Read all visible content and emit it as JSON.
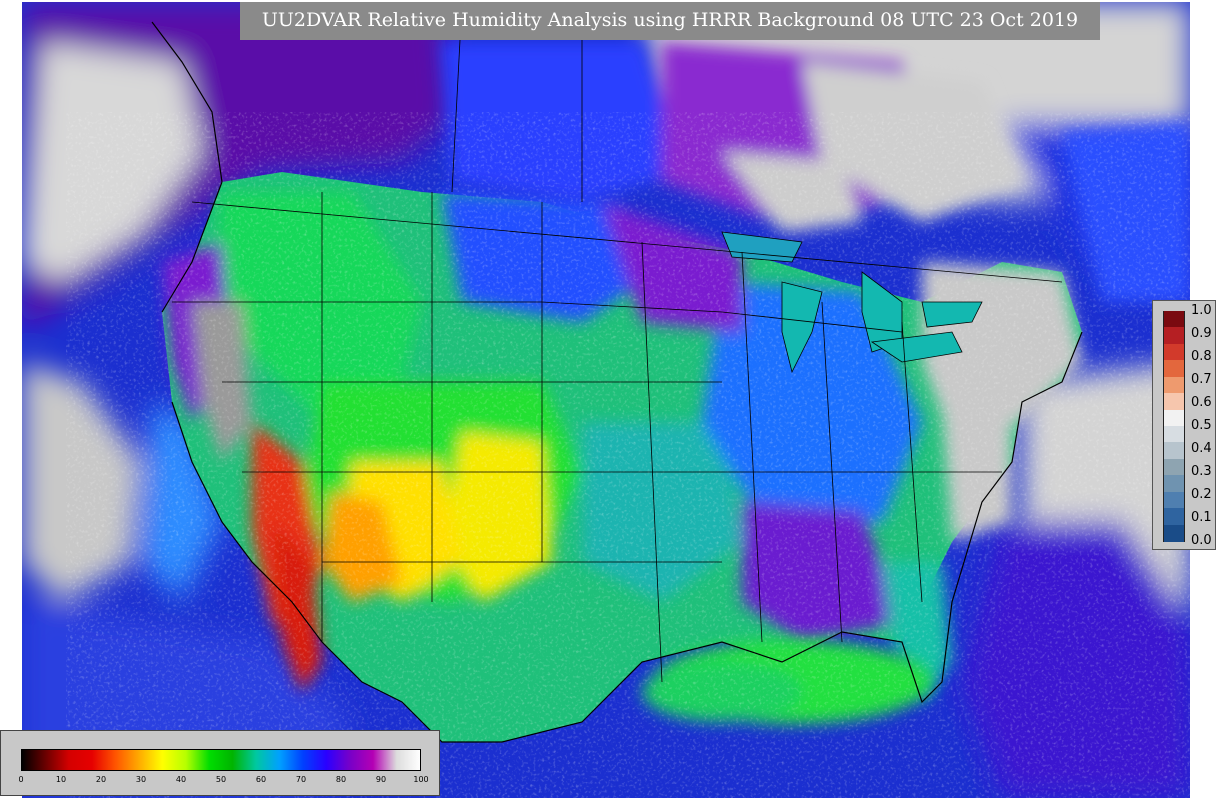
{
  "title": "UU2DVAR Relative Humidity Analysis using HRRR Background 08 UTC 23 Oct 2019",
  "colorbar_right": {
    "ticks": [
      "1.0",
      "0.9",
      "0.8",
      "0.7",
      "0.6",
      "0.5",
      "0.4",
      "0.3",
      "0.2",
      "0.1",
      "0.0"
    ],
    "colors": [
      "#7a0a10",
      "#b51f23",
      "#d23a2b",
      "#e3673d",
      "#ee9a6e",
      "#f6c6ad",
      "#f2f2f2",
      "#d7dde2",
      "#b7c4cd",
      "#8ea4b1",
      "#6f93b0",
      "#4f7fb0",
      "#2f64a0",
      "#1a4c88"
    ]
  },
  "colorbar_bottom": {
    "ticks": [
      "0",
      "10",
      "20",
      "30",
      "40",
      "50",
      "60",
      "70",
      "80",
      "90",
      "100"
    ],
    "stops": [
      "#000000",
      "#6a0000",
      "#d40000",
      "#e60000",
      "#ff5500",
      "#ffaa00",
      "#ffff00",
      "#b6ff00",
      "#00dd00",
      "#00b400",
      "#00c8a0",
      "#00a0ff",
      "#0040ff",
      "#2a00ff",
      "#7800c8",
      "#b400b4",
      "#dcdcdc",
      "#ffffff"
    ]
  },
  "map_colors": {
    "ocean": "#1b2fd0",
    "dry": "#e32b1a",
    "very_dry": "#ff8c00",
    "semi_dry": "#ffe000",
    "mid": "#14dc2a",
    "moist": "#13c8a0",
    "wet": "#2d6cff",
    "very_wet": "#7a10c8",
    "saturated": "#cfcfcf"
  }
}
